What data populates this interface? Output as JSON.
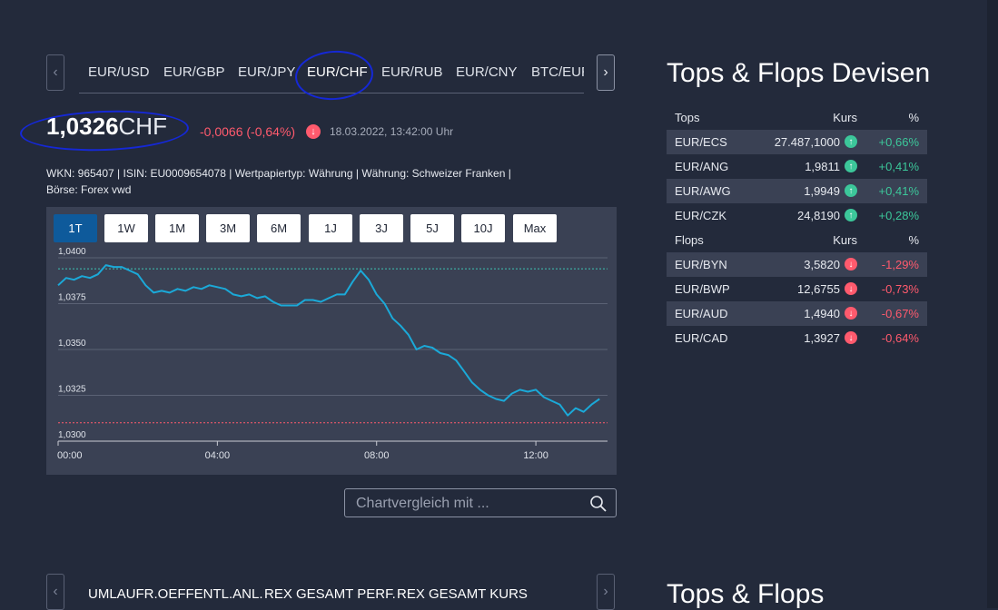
{
  "tabs": [
    "EUR/USD",
    "EUR/GBP",
    "EUR/JPY",
    "EUR/CHF",
    "EUR/RUB",
    "EUR/CNY",
    "BTC/EUR"
  ],
  "active_tab": "EUR/CHF",
  "quote": {
    "price": "1,0326",
    "unit": "CHF",
    "change": "-0,0066 (-0,64%)",
    "timestamp": "18.03.2022, 13:42:00 Uhr"
  },
  "meta_line1": "WKN: 965407 | ISIN: EU0009654078 | Wertpapiertyp: Währung | Währung: Schweizer Franken |",
  "meta_line2": "Börse: Forex vwd",
  "ranges": [
    "1T",
    "1W",
    "1M",
    "3M",
    "6M",
    "1J",
    "3J",
    "5J",
    "10J",
    "Max"
  ],
  "active_range": "1T",
  "chart_data": {
    "type": "line",
    "y_ticks": [
      "1,0400",
      "1,0375",
      "1,0350",
      "1,0325",
      "1,0300"
    ],
    "x_ticks": [
      "00:00",
      "04:00",
      "08:00",
      "12:00"
    ],
    "ylim": [
      1.03,
      1.04
    ],
    "ref_high": 1.0394,
    "ref_low": 1.031,
    "series": [
      {
        "x": [
          0.0,
          0.2,
          0.4,
          0.6,
          0.8,
          1.0,
          1.2,
          1.4,
          1.6,
          1.8,
          2.0,
          2.2,
          2.4,
          2.6,
          2.8,
          3.0,
          3.2,
          3.4,
          3.6,
          3.8,
          4.0,
          4.2,
          4.4,
          4.6,
          4.8,
          5.0,
          5.2,
          5.4,
          5.6,
          5.8,
          6.0,
          6.2,
          6.4,
          6.6,
          6.8,
          7.0,
          7.2,
          7.4,
          7.6,
          7.8,
          8.0,
          8.2,
          8.4,
          8.6,
          8.8,
          9.0,
          9.2,
          9.4,
          9.6,
          9.8,
          10.0,
          10.2,
          10.4,
          10.6,
          10.8,
          11.0,
          11.2,
          11.4,
          11.6,
          11.8,
          12.0,
          12.2,
          12.4,
          12.6,
          12.8,
          13.0,
          13.2,
          13.4,
          13.6
        ],
        "y": [
          1.0385,
          1.0389,
          1.0388,
          1.039,
          1.0389,
          1.0391,
          1.0396,
          1.0395,
          1.0395,
          1.0393,
          1.0391,
          1.0385,
          1.0381,
          1.0382,
          1.0381,
          1.0383,
          1.0382,
          1.0384,
          1.0383,
          1.0385,
          1.0384,
          1.0383,
          1.038,
          1.0379,
          1.038,
          1.0378,
          1.0379,
          1.0376,
          1.0374,
          1.0374,
          1.0374,
          1.0377,
          1.0377,
          1.0376,
          1.0378,
          1.038,
          1.038,
          1.0387,
          1.0393,
          1.0388,
          1.038,
          1.0375,
          1.0367,
          1.0363,
          1.0358,
          1.035,
          1.0352,
          1.0351,
          1.0348,
          1.0347,
          1.0344,
          1.0338,
          1.0332,
          1.0328,
          1.0325,
          1.0323,
          1.0322,
          1.0326,
          1.0328,
          1.0327,
          1.0328,
          1.0324,
          1.0322,
          1.032,
          1.0314,
          1.0318,
          1.0316,
          1.032,
          1.0323
        ]
      }
    ]
  },
  "search": {
    "placeholder": "Chartvergleich mit ..."
  },
  "bottom_tabs": [
    "UMLAUFR.OEFFENTL.ANL.",
    "REX GESAMT PERF.",
    "REX GESAMT KURS"
  ],
  "tops_flops": {
    "title": "Tops & Flops Devisen",
    "col_kurs": "Kurs",
    "col_pct": "%",
    "tops_label": "Tops",
    "flops_label": "Flops",
    "tops": [
      {
        "name": "EUR/ECS",
        "kurs": "27.487,1000",
        "pct": "+0,66%"
      },
      {
        "name": "EUR/ANG",
        "kurs": "1,9811",
        "pct": "+0,41%"
      },
      {
        "name": "EUR/AWG",
        "kurs": "1,9949",
        "pct": "+0,41%"
      },
      {
        "name": "EUR/CZK",
        "kurs": "24,8190",
        "pct": "+0,28%"
      }
    ],
    "flops": [
      {
        "name": "EUR/BYN",
        "kurs": "3,5820",
        "pct": "-1,29%"
      },
      {
        "name": "EUR/BWP",
        "kurs": "12,6755",
        "pct": "-0,73%"
      },
      {
        "name": "EUR/AUD",
        "kurs": "1,4940",
        "pct": "-0,67%"
      },
      {
        "name": "EUR/CAD",
        "kurs": "1,3927",
        "pct": "-0,64%"
      }
    ]
  },
  "bottom_title": "Tops & Flops",
  "colors": {
    "accent": "#0e5a9b",
    "line": "#1ba9d8",
    "negative": "#ff5a6d",
    "positive": "#3cc79a"
  }
}
